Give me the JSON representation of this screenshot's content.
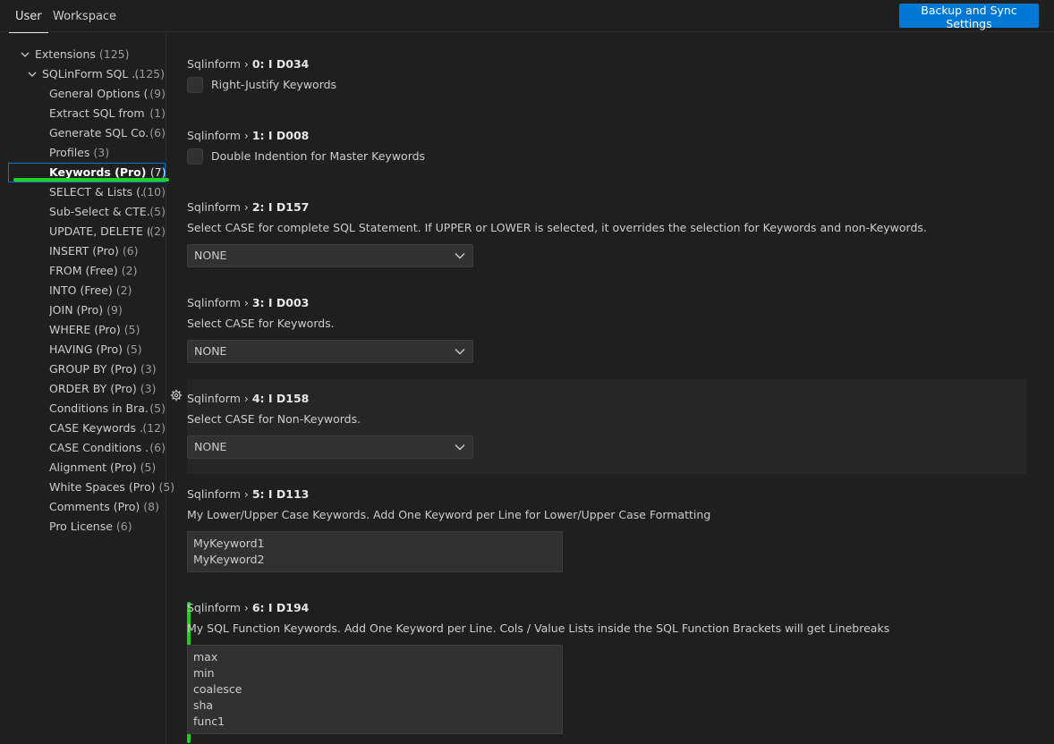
{
  "tabs": {
    "user": "User",
    "workspace": "Workspace"
  },
  "sync_button": "Backup and Sync Settings",
  "tree": {
    "extensions": {
      "label": "Extensions",
      "count": "(125)"
    },
    "sqlinform": {
      "label": "SQLinForm SQL ...",
      "count": "(125)"
    },
    "items": [
      {
        "label": "General Options (...",
        "count": "(9)"
      },
      {
        "label": "Extract SQL from ...",
        "count": "(1)"
      },
      {
        "label": "Generate SQL Co...",
        "count": "(6)"
      },
      {
        "label": "Profiles",
        "count": "(3)"
      },
      {
        "label": "Keywords (Pro)",
        "count": "(7)"
      },
      {
        "label": "SELECT & Lists (...",
        "count": "(10)"
      },
      {
        "label": "Sub-Select & CTE...",
        "count": "(5)"
      },
      {
        "label": "UPDATE, DELETE (...",
        "count": "(2)"
      },
      {
        "label": "INSERT (Pro)",
        "count": "(6)"
      },
      {
        "label": "FROM (Free)",
        "count": "(2)"
      },
      {
        "label": "INTO (Free)",
        "count": "(2)"
      },
      {
        "label": "JOIN (Pro)",
        "count": "(9)"
      },
      {
        "label": "WHERE (Pro)",
        "count": "(5)"
      },
      {
        "label": "HAVING (Pro)",
        "count": "(5)"
      },
      {
        "label": "GROUP BY (Pro)",
        "count": "(3)"
      },
      {
        "label": "ORDER BY (Pro)",
        "count": "(3)"
      },
      {
        "label": "Conditions in Bra...",
        "count": "(5)"
      },
      {
        "label": "CASE Keywords ...",
        "count": "(12)"
      },
      {
        "label": "CASE Conditions ...",
        "count": "(6)"
      },
      {
        "label": "Alignment (Pro)",
        "count": "(5)"
      },
      {
        "label": "White Spaces (Pro)",
        "count": "(5)"
      },
      {
        "label": "Comments (Pro)",
        "count": "(8)"
      },
      {
        "label": "Pro License",
        "count": "(6)"
      }
    ]
  },
  "settings": {
    "s0": {
      "prefix": "Sqlinform › ",
      "name": "0: I D034",
      "checkbox_label": "Right-Justify Keywords"
    },
    "s1": {
      "prefix": "Sqlinform › ",
      "name": "1: I D008",
      "checkbox_label": "Double Indention for Master Keywords"
    },
    "s2": {
      "prefix": "Sqlinform › ",
      "name": "2: I D157",
      "desc": "Select CASE for complete SQL Statement. If UPPER or LOWER is selected, it overrides the selection for Keywords and non-Keywords.",
      "value": "NONE"
    },
    "s3": {
      "prefix": "Sqlinform › ",
      "name": "3: I D003",
      "desc": "Select CASE for Keywords.",
      "value": "NONE"
    },
    "s4": {
      "prefix": "Sqlinform › ",
      "name": "4: I D158",
      "desc": "Select CASE for Non-Keywords.",
      "value": "NONE"
    },
    "s5": {
      "prefix": "Sqlinform › ",
      "name": "5: I D113",
      "desc": "My Lower/Upper Case Keywords. Add One Keyword per Line for Lower/Upper Case Formatting",
      "lines": [
        "MyKeyword1",
        "MyKeyword2"
      ]
    },
    "s6": {
      "prefix": "Sqlinform › ",
      "name": "6: I D194",
      "desc": "My SQL Function Keywords. Add One Keyword per Line. Cols / Value Lists inside the SQL Function Brackets will get Linebreaks",
      "lines": [
        "max",
        "min",
        "coalesce",
        "sha",
        "func1"
      ]
    }
  },
  "colors": {
    "accent": "#0078d4",
    "annotation": "#20d020",
    "background": "#1f1f1f"
  }
}
